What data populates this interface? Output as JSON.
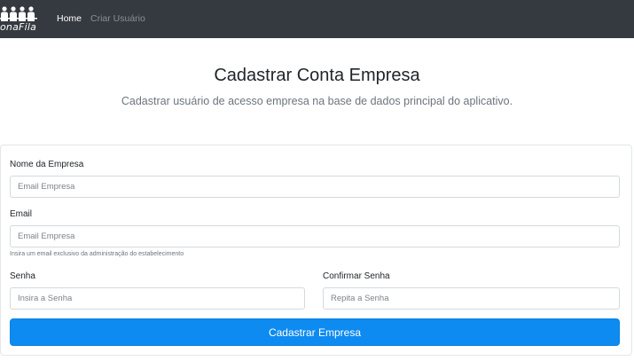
{
  "navbar": {
    "logo_text": "onaFila",
    "home_label": "Home",
    "criar_label": "Criar Usuário"
  },
  "header": {
    "title": "Cadastrar Conta Empresa",
    "lead": "Cadastrar usuário de acesso empresa na base de dados principal do aplicativo."
  },
  "form": {
    "nome": {
      "label": "Nome da Empresa",
      "placeholder": "Email Empresa"
    },
    "email": {
      "label": "Email",
      "placeholder": "Email Empresa",
      "help": "Insira um email exclusivo da administração do estabelecimento"
    },
    "senha": {
      "label": "Senha",
      "placeholder": "Insira a Senha"
    },
    "confirmar": {
      "label": "Confirmar Senha",
      "placeholder": "Repita a Senha"
    },
    "submit_label": "Cadastrar Empresa"
  },
  "colors": {
    "navbar": "#343a40",
    "primary": "#0d8bf0",
    "muted": "#6c757d"
  },
  "icons": {
    "logo": "people-queue-icon"
  }
}
